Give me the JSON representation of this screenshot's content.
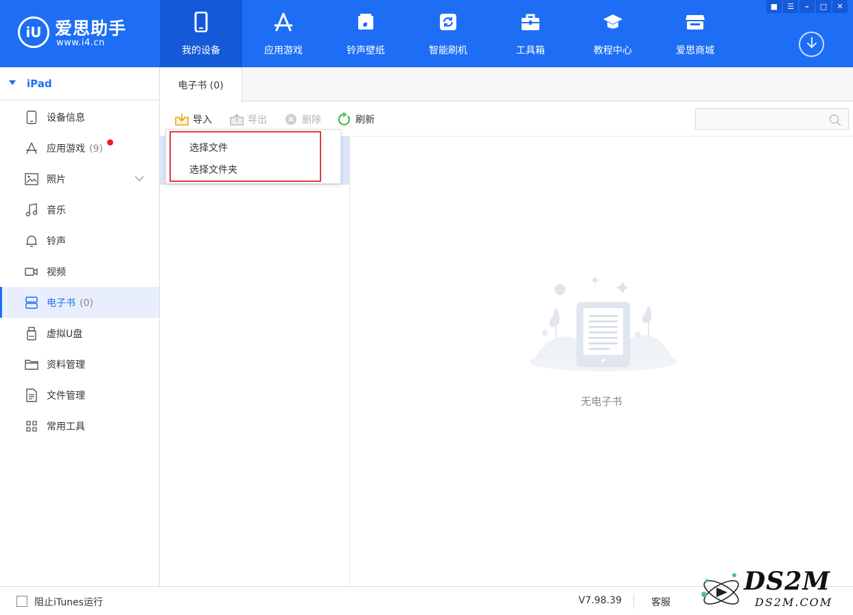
{
  "header": {
    "logo_badge": "iU",
    "logo_name": "爱思助手",
    "logo_url": "www.i4.cn",
    "nav": [
      {
        "label": "我的设备",
        "icon": "phone-icon",
        "active": true
      },
      {
        "label": "应用游戏",
        "icon": "app-store-icon",
        "active": false
      },
      {
        "label": "铃声壁纸",
        "icon": "music-note-icon",
        "active": false
      },
      {
        "label": "智能刷机",
        "icon": "refresh-icon",
        "active": false
      },
      {
        "label": "工具箱",
        "icon": "toolbox-icon",
        "active": false
      },
      {
        "label": "教程中心",
        "icon": "graduation-cap-icon",
        "active": false
      },
      {
        "label": "爱思商城",
        "icon": "store-icon",
        "active": false
      }
    ],
    "window_controls": [
      "skin-icon",
      "menu-icon",
      "minimize-icon",
      "maximize-icon",
      "close-icon"
    ]
  },
  "sidebar": {
    "device": "iPad",
    "items": [
      {
        "label": "设备信息",
        "icon": "tablet-icon",
        "count": ""
      },
      {
        "label": "应用游戏",
        "icon": "app-store-icon",
        "count": "(9)",
        "badge": true
      },
      {
        "label": "照片",
        "icon": "image-icon",
        "count": "",
        "expandable": true
      },
      {
        "label": "音乐",
        "icon": "music-note-icon",
        "count": ""
      },
      {
        "label": "铃声",
        "icon": "bell-icon",
        "count": ""
      },
      {
        "label": "视频",
        "icon": "video-camera-icon",
        "count": ""
      },
      {
        "label": "电子书",
        "icon": "book-icon",
        "count": "(0)",
        "active": true
      },
      {
        "label": "虚拟U盘",
        "icon": "usb-drive-icon",
        "count": ""
      },
      {
        "label": "资料管理",
        "icon": "folder-icon",
        "count": ""
      },
      {
        "label": "文件管理",
        "icon": "document-icon",
        "count": ""
      },
      {
        "label": "常用工具",
        "icon": "grid-icon",
        "count": ""
      }
    ]
  },
  "main": {
    "tab_label": "电子书 (0)",
    "toolbar": {
      "import": "导入",
      "export": "导出",
      "delete": "删除",
      "refresh": "刷新"
    },
    "search_placeholder": "",
    "dropdown": [
      "选择文件",
      "选择文件夹"
    ],
    "empty_text": "无电子书"
  },
  "statusbar": {
    "checkbox_label": "阻止iTunes运行",
    "version": "V7.98.39",
    "service": "客服"
  },
  "watermark": {
    "big": "DS2M",
    "small": "DS2M.COM"
  },
  "colors": {
    "brand_blue": "#1d6ef5",
    "active_nav": "#1459d8",
    "highlight_red": "#e0393e"
  }
}
